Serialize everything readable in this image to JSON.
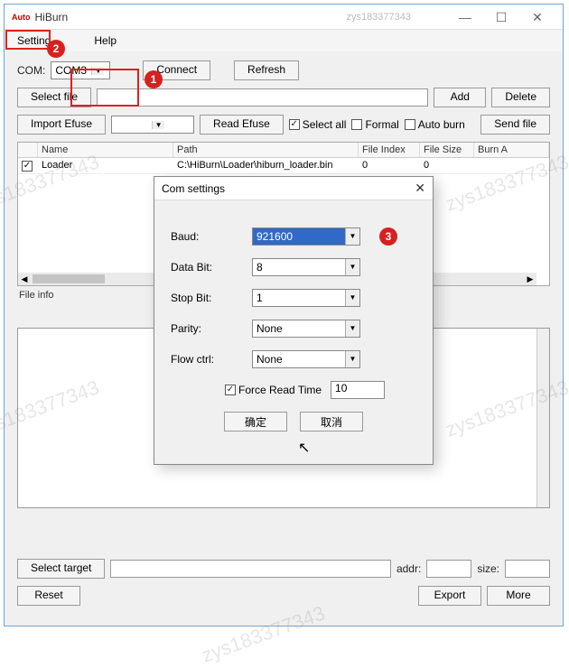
{
  "window": {
    "logo_text": "Auto",
    "title": "HiBurn",
    "watermark": "zys183377343",
    "controls": {
      "min": "—",
      "max": "☐",
      "close": "✕"
    }
  },
  "menubar": {
    "setting": "Setting",
    "help": "Help"
  },
  "toolbar": {
    "com_label": "COM:",
    "com_value": "COM3",
    "connect": "Connect",
    "refresh": "Refresh",
    "select_file": "Select file",
    "add": "Add",
    "delete": "Delete",
    "import_efuse": "Import Efuse",
    "efuse_value": "",
    "read_efuse": "Read Efuse",
    "select_all": "Select all",
    "formal": "Formal",
    "auto_burn": "Auto burn",
    "send_file": "Send file"
  },
  "table": {
    "headers": [
      "",
      "Name",
      "Path",
      "File Index",
      "File Size",
      "Burn A"
    ],
    "row": {
      "checked": "✓",
      "name": "Loader",
      "path": "C:\\HiBurn\\Loader\\hiburn_loader.bin",
      "file_index": "0",
      "file_size": "0"
    },
    "file_info": "File info"
  },
  "dialog": {
    "title": "Com settings",
    "close": "✕",
    "baud_label": "Baud:",
    "baud_value": "921600",
    "databit_label": "Data Bit:",
    "databit_value": "8",
    "stopbit_label": "Stop Bit:",
    "stopbit_value": "1",
    "parity_label": "Parity:",
    "parity_value": "None",
    "flow_label": "Flow ctrl:",
    "flow_value": "None",
    "force_read_label": "Force Read Time",
    "force_read_value": "10",
    "ok": "确定",
    "cancel": "取消"
  },
  "bottom": {
    "select_target": "Select target",
    "addr_label": "addr:",
    "size_label": "size:",
    "reset": "Reset",
    "export": "Export",
    "more": "More"
  },
  "badges": {
    "one": "1",
    "two": "2",
    "three": "3"
  }
}
